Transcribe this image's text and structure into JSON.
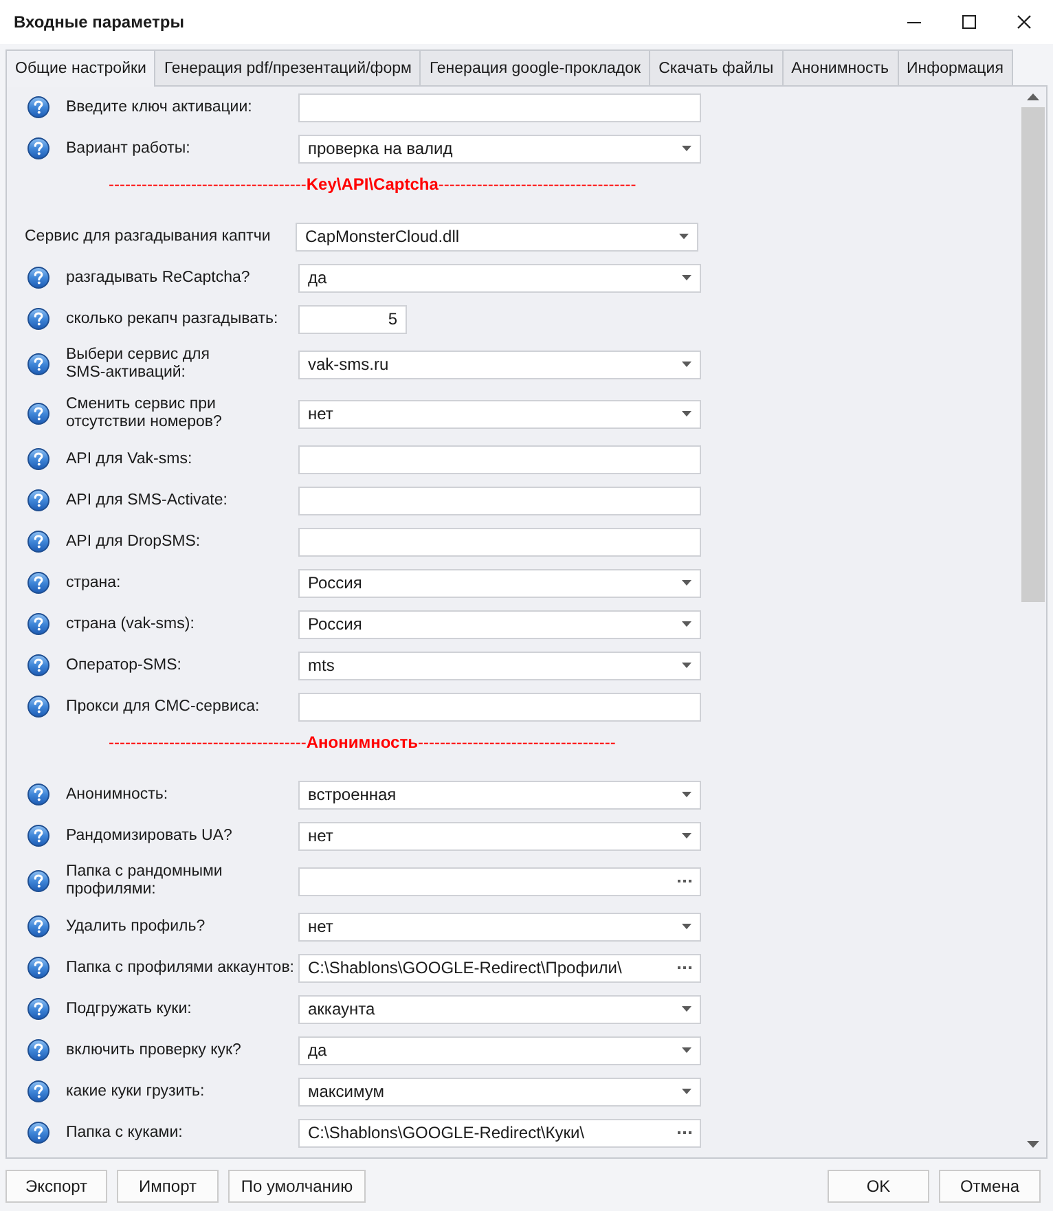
{
  "window": {
    "title": "Входные параметры"
  },
  "tabs": [
    {
      "label": "Общие настройки",
      "selected": true
    },
    {
      "label": "Генерация pdf/презентаций/форм",
      "selected": false
    },
    {
      "label": "Генерация google-прокладок",
      "selected": false
    },
    {
      "label": "Скачать файлы",
      "selected": false
    },
    {
      "label": "Анонимность",
      "selected": false
    },
    {
      "label": "Информация",
      "selected": false
    }
  ],
  "form": {
    "rows": [
      {
        "kind": "text",
        "help_icon": true,
        "label": "Введите ключ активации:"
      },
      {
        "kind": "select",
        "help_icon": true,
        "label": "Вариант работы:",
        "value": "проверка на валид"
      },
      {
        "kind": "separator",
        "text": "------------------------------------**Key\\API\\Captcha**------------------------------------"
      },
      {
        "kind": "select",
        "help_icon": false,
        "label": "Сервис для разгадывания каптчи",
        "value": "CapMonsterCloud.dll"
      },
      {
        "kind": "select",
        "help_icon": true,
        "label": "разгадывать ReCaptcha?",
        "value": "да"
      },
      {
        "kind": "number",
        "help_icon": true,
        "label": "сколько рекапч разгадывать:",
        "value": "5"
      },
      {
        "kind": "select",
        "help_icon": true,
        "label": "Выбери сервис для\nSMS-активаций:",
        "value": "vak-sms.ru"
      },
      {
        "kind": "select",
        "help_icon": true,
        "label": "Сменить сервис при\nотсутствии номеров?",
        "value": "нет"
      },
      {
        "kind": "text",
        "help_icon": true,
        "label": "API для Vak-sms:"
      },
      {
        "kind": "text",
        "help_icon": true,
        "label": "API для SMS-Activate:"
      },
      {
        "kind": "text",
        "help_icon": true,
        "label": "API для DropSMS:"
      },
      {
        "kind": "select",
        "help_icon": true,
        "label": "страна:",
        "value": "Россия"
      },
      {
        "kind": "select",
        "help_icon": true,
        "label": "страна (vak-sms):",
        "value": "Россия"
      },
      {
        "kind": "select",
        "help_icon": true,
        "label": "Оператор-SMS:",
        "value": "mts"
      },
      {
        "kind": "text",
        "help_icon": true,
        "label": "Прокси для СМС-сервиса:"
      },
      {
        "kind": "separator",
        "text": "------------------------------------**Анонимность**------------------------------------"
      },
      {
        "kind": "select",
        "help_icon": true,
        "label": "Анонимность:",
        "value": "встроенная"
      },
      {
        "kind": "select",
        "help_icon": true,
        "label": "Рандомизировать UA?",
        "value": "нет"
      },
      {
        "kind": "browse",
        "help_icon": true,
        "label": "Папка с рандомными\nпрофилями:"
      },
      {
        "kind": "select",
        "help_icon": true,
        "label": "Удалить профиль?",
        "value": "нет"
      },
      {
        "kind": "browse",
        "help_icon": true,
        "label": "Папка с профилями аккаунтов:",
        "value": "C:\\Shablons\\GOOGLE-Redirect\\Профили\\"
      },
      {
        "kind": "select",
        "help_icon": true,
        "label": "Подгружать куки:",
        "value": "аккаунта"
      },
      {
        "kind": "select",
        "help_icon": true,
        "label": "включить проверку кук?",
        "value": "да"
      },
      {
        "kind": "select",
        "help_icon": true,
        "label": "какие куки грузить:",
        "value": "максимум"
      },
      {
        "kind": "browse",
        "help_icon": true,
        "label": "Папка с куками:",
        "value": "C:\\Shablons\\GOOGLE-Redirect\\Куки\\"
      }
    ]
  },
  "footer": {
    "left_buttons": [
      "Экспорт",
      "Импорт",
      "По умолчанию"
    ],
    "right_buttons": [
      "OK",
      "Отмена"
    ]
  }
}
